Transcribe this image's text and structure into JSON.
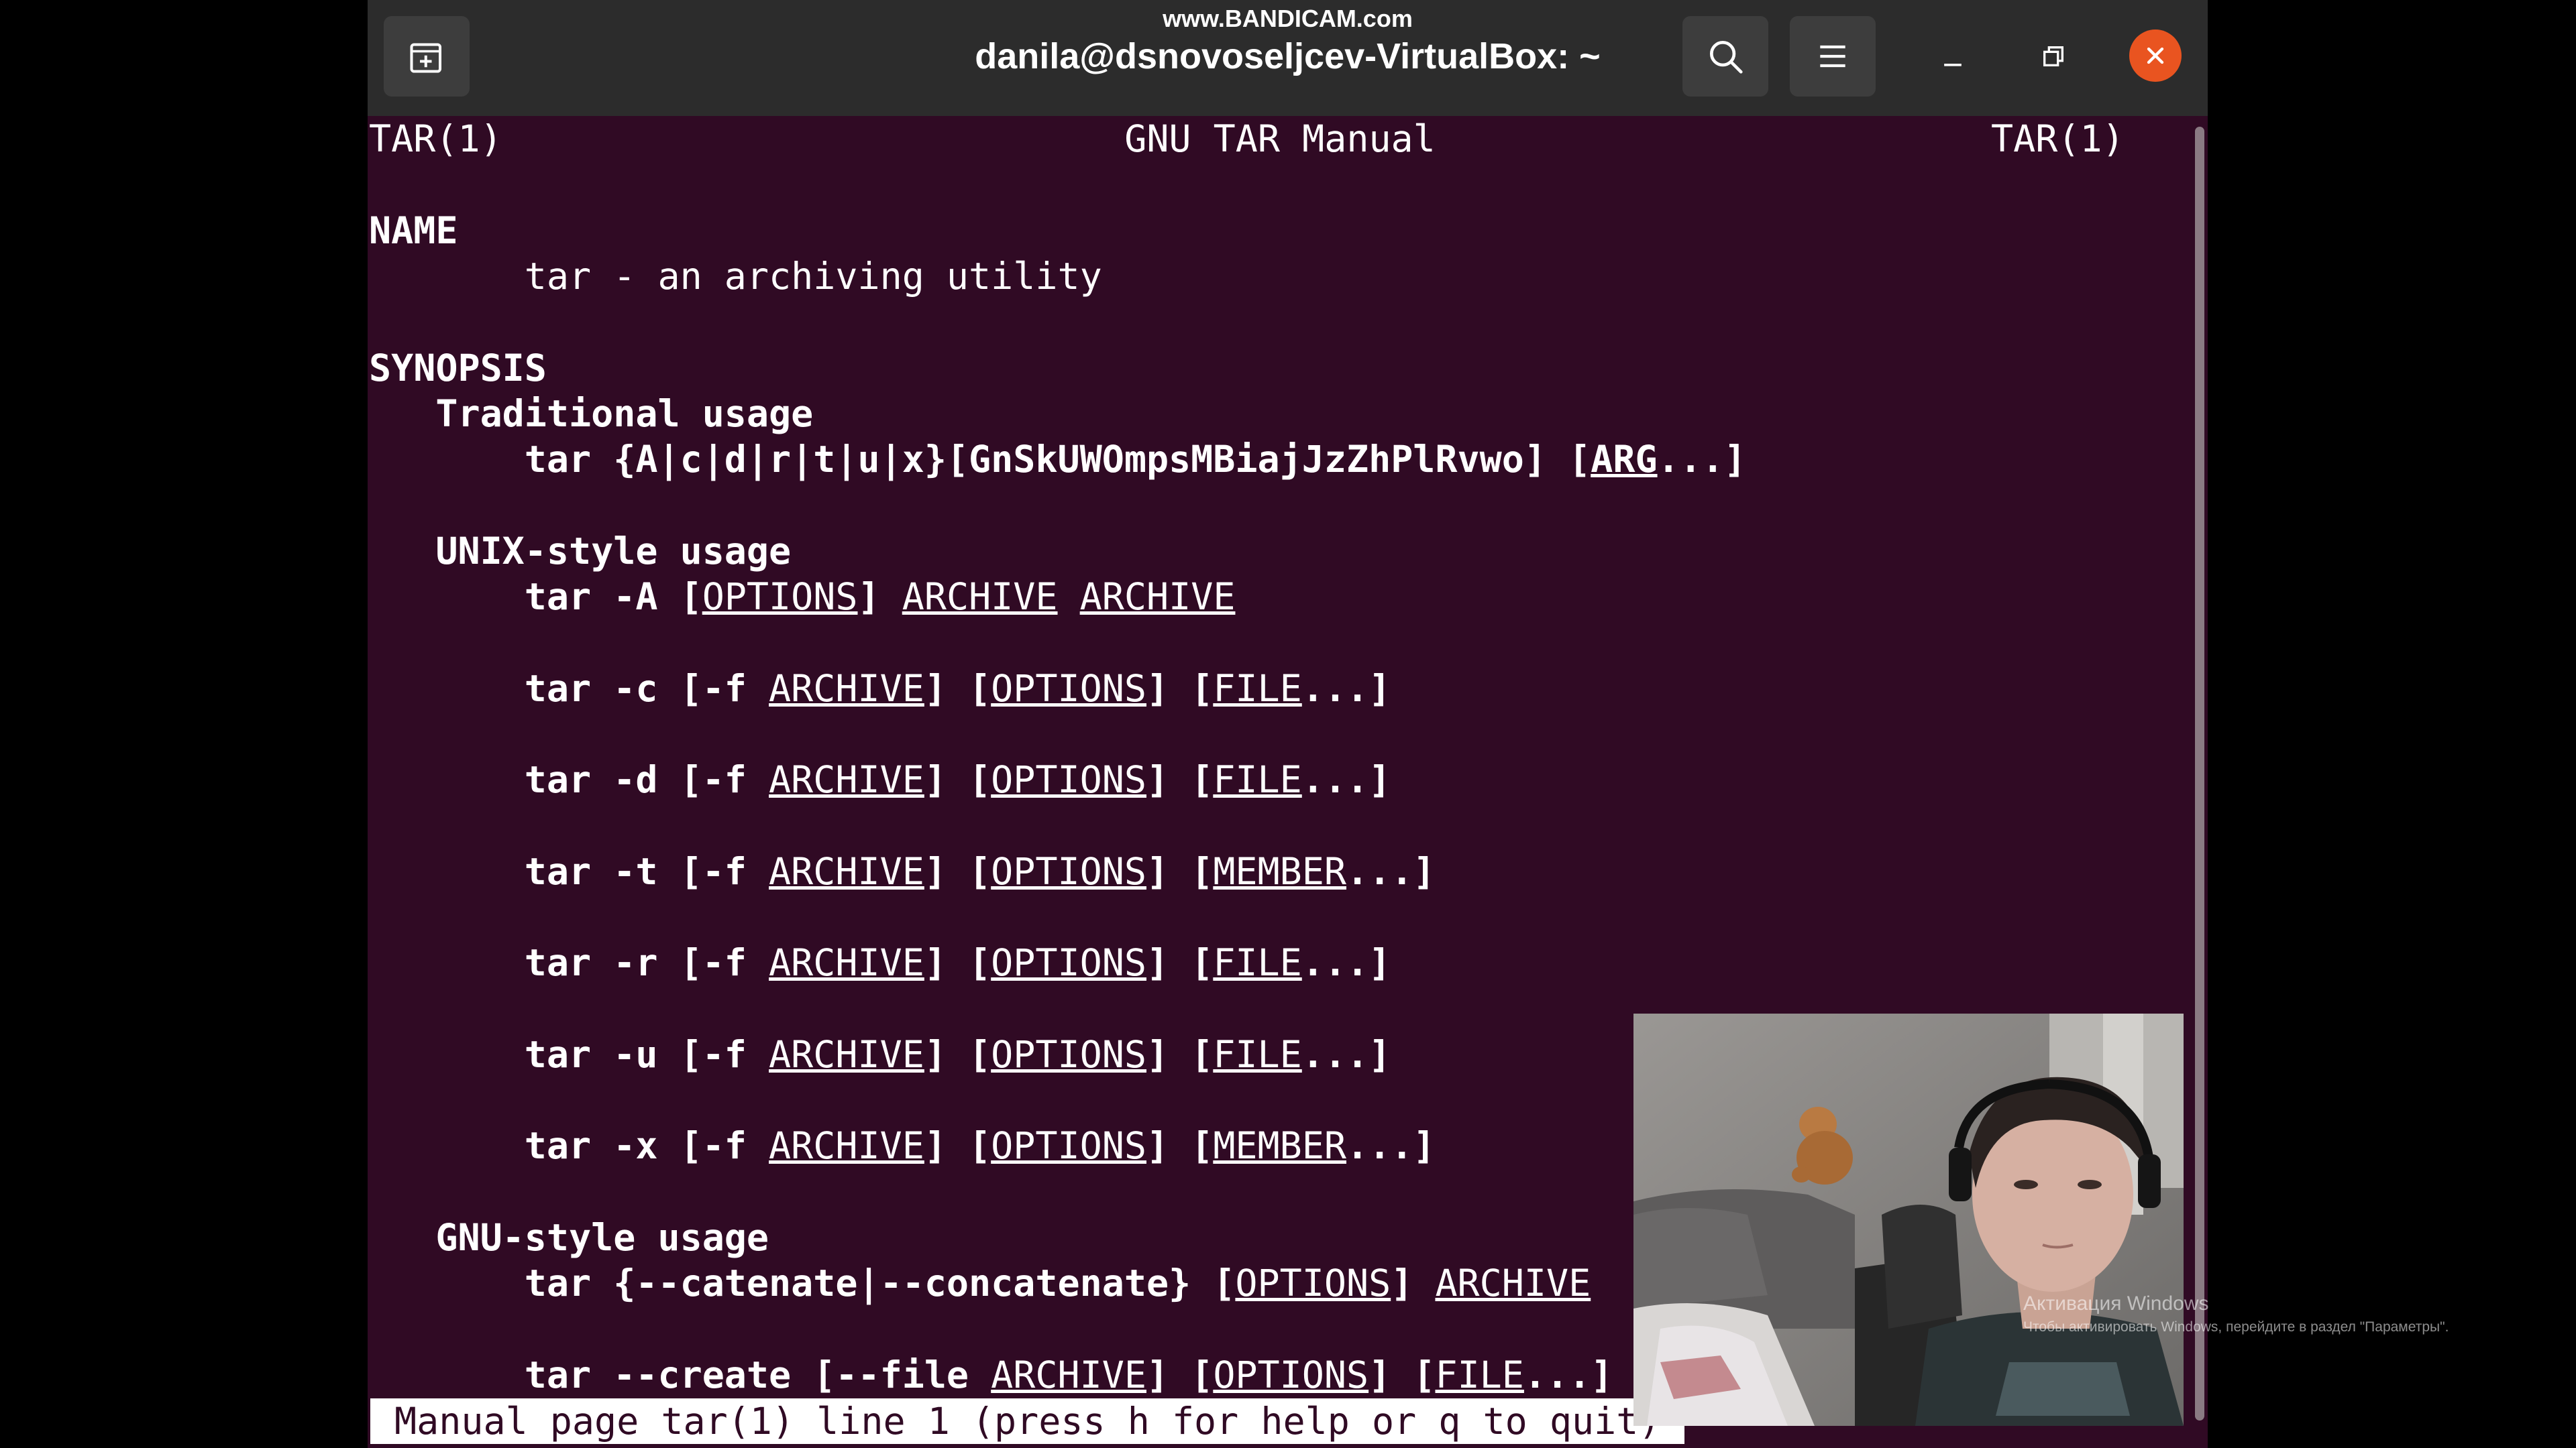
{
  "watermark": "www.BANDICAM.com",
  "window": {
    "title": "danila@dsnovoseljcev-VirtualBox: ~",
    "icons": {
      "new_tab": "new-tab-icon",
      "search": "search-icon",
      "menu": "hamburger-menu-icon",
      "minimize": "minimize-icon",
      "restore": "restore-icon",
      "close": "close-icon"
    },
    "accent_color": "#e95420",
    "terminal_background": "#300a24"
  },
  "man": {
    "header": {
      "left": "TAR(1)",
      "center": "GNU TAR Manual",
      "right": "TAR(1)"
    },
    "lines": [
      [
        {
          "t": "NAME",
          "s": "b"
        }
      ],
      [
        {
          "t": "       tar - an archiving utility",
          "s": ""
        }
      ],
      [
        {
          "t": "SYNOPSIS",
          "s": "b"
        }
      ],
      [
        {
          "t": "   Traditional usage",
          "s": "b"
        }
      ],
      [
        {
          "t": "       tar {A|c|d|r|t|u|x}[GnSkUWOmpsMBiajJzZhPlRvwo] [",
          "s": "b"
        },
        {
          "t": "ARG",
          "s": "bu"
        },
        {
          "t": "...]",
          "s": "b"
        }
      ],
      [
        {
          "t": "   UNIX-style usage",
          "s": "b"
        }
      ],
      [
        {
          "t": "       tar -A [",
          "s": "b"
        },
        {
          "t": "OPTIONS",
          "s": "u"
        },
        {
          "t": "] ",
          "s": "b"
        },
        {
          "t": "ARCHIVE",
          "s": "u"
        },
        {
          "t": " ",
          "s": ""
        },
        {
          "t": "ARCHIVE",
          "s": "u"
        }
      ],
      [
        {
          "t": "       tar -c [-f ",
          "s": "b"
        },
        {
          "t": "ARCHIVE",
          "s": "u"
        },
        {
          "t": "] [",
          "s": "b"
        },
        {
          "t": "OPTIONS",
          "s": "u"
        },
        {
          "t": "] [",
          "s": "b"
        },
        {
          "t": "FILE",
          "s": "u"
        },
        {
          "t": "...]",
          "s": "b"
        }
      ],
      [
        {
          "t": "       tar -d [-f ",
          "s": "b"
        },
        {
          "t": "ARCHIVE",
          "s": "u"
        },
        {
          "t": "] [",
          "s": "b"
        },
        {
          "t": "OPTIONS",
          "s": "u"
        },
        {
          "t": "] [",
          "s": "b"
        },
        {
          "t": "FILE",
          "s": "u"
        },
        {
          "t": "...]",
          "s": "b"
        }
      ],
      [
        {
          "t": "       tar -t [-f ",
          "s": "b"
        },
        {
          "t": "ARCHIVE",
          "s": "u"
        },
        {
          "t": "] [",
          "s": "b"
        },
        {
          "t": "OPTIONS",
          "s": "u"
        },
        {
          "t": "] [",
          "s": "b"
        },
        {
          "t": "MEMBER",
          "s": "u"
        },
        {
          "t": "...]",
          "s": "b"
        }
      ],
      [
        {
          "t": "       tar -r [-f ",
          "s": "b"
        },
        {
          "t": "ARCHIVE",
          "s": "u"
        },
        {
          "t": "] [",
          "s": "b"
        },
        {
          "t": "OPTIONS",
          "s": "u"
        },
        {
          "t": "] [",
          "s": "b"
        },
        {
          "t": "FILE",
          "s": "u"
        },
        {
          "t": "...]",
          "s": "b"
        }
      ],
      [
        {
          "t": "       tar -u [-f ",
          "s": "b"
        },
        {
          "t": "ARCHIVE",
          "s": "u"
        },
        {
          "t": "] [",
          "s": "b"
        },
        {
          "t": "OPTIONS",
          "s": "u"
        },
        {
          "t": "] [",
          "s": "b"
        },
        {
          "t": "FILE",
          "s": "u"
        },
        {
          "t": "...]",
          "s": "b"
        }
      ],
      [
        {
          "t": "       tar -x [-f ",
          "s": "b"
        },
        {
          "t": "ARCHIVE",
          "s": "u"
        },
        {
          "t": "] [",
          "s": "b"
        },
        {
          "t": "OPTIONS",
          "s": "u"
        },
        {
          "t": "] [",
          "s": "b"
        },
        {
          "t": "MEMBER",
          "s": "u"
        },
        {
          "t": "...]",
          "s": "b"
        }
      ],
      [
        {
          "t": "   GNU-style usage",
          "s": "b"
        }
      ],
      [
        {
          "t": "       tar {--catenate|--concatenate} [",
          "s": "b"
        },
        {
          "t": "OPTIONS",
          "s": "u"
        },
        {
          "t": "] ",
          "s": "b"
        },
        {
          "t": "ARCHIVE",
          "s": "u"
        }
      ],
      [
        {
          "t": "       tar --create [--file ",
          "s": "b"
        },
        {
          "t": "ARCHIVE",
          "s": "u"
        },
        {
          "t": "] [",
          "s": "b"
        },
        {
          "t": "OPTIONS",
          "s": "u"
        },
        {
          "t": "] [",
          "s": "b"
        },
        {
          "t": "FILE",
          "s": "u"
        },
        {
          "t": "...]",
          "s": "b"
        }
      ]
    ],
    "status": "Manual page tar(1) line 1 (press h for help or q to quit)"
  },
  "overlay": {
    "activation_title": "Активация Windows",
    "activation_text": "Чтобы активировать Windows, перейдите в раздел \"Параметры\"."
  }
}
